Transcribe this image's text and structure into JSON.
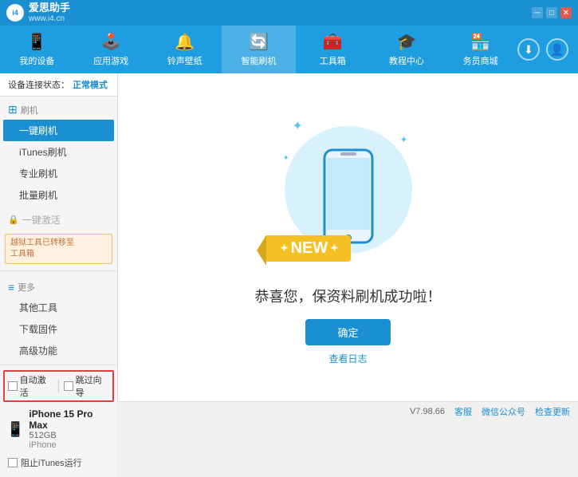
{
  "app": {
    "logo_text": "i4",
    "brand_name": "爱思助手",
    "brand_url": "www.i4.cn"
  },
  "window_controls": {
    "minimize": "─",
    "maximize": "□",
    "close": "✕"
  },
  "navbar": {
    "items": [
      {
        "id": "my-device",
        "label": "我的设备",
        "icon": "📱"
      },
      {
        "id": "apps-games",
        "label": "应用游戏",
        "icon": "👤"
      },
      {
        "id": "ringtones",
        "label": "铃声壁纸",
        "icon": "🔔"
      },
      {
        "id": "smart-flash",
        "label": "智能刷机",
        "icon": "🔄",
        "active": true
      },
      {
        "id": "toolbox",
        "label": "工具箱",
        "icon": "🧰"
      },
      {
        "id": "tutorial",
        "label": "教程中心",
        "icon": "🎓"
      },
      {
        "id": "service",
        "label": "务员商城",
        "icon": "🗂️"
      }
    ],
    "download_icon": "⬇",
    "user_icon": "👤"
  },
  "sidebar": {
    "status_label": "设备连接状态：",
    "status_mode": "正常模式",
    "section_flash": {
      "icon": "🔄",
      "label": "刷机"
    },
    "flash_items": [
      {
        "id": "one-click-flash",
        "label": "一键刷机",
        "active": true
      },
      {
        "id": "itunes-flash",
        "label": "iTunes刷机"
      },
      {
        "id": "pro-flash",
        "label": "专业刷机"
      },
      {
        "id": "batch-flash",
        "label": "批量刷机"
      }
    ],
    "one_click_activate": {
      "label": "一键激活",
      "disabled": true
    },
    "warning_text": "越狱工具已转移至\n工具箱",
    "section_more": {
      "icon": "≡",
      "label": "更多"
    },
    "more_items": [
      {
        "id": "other-tools",
        "label": "其他工具"
      },
      {
        "id": "download-firmware",
        "label": "下载固件"
      },
      {
        "id": "advanced",
        "label": "高级功能"
      }
    ],
    "auto_activate_label": "自动激活",
    "quick_guide_label": "跳过向导",
    "device": {
      "name": "iPhone 15 Pro Max",
      "storage": "512GB",
      "type": "iPhone"
    },
    "itunes_label": "阻止iTunes运行"
  },
  "content": {
    "success_title": "恭喜您，保资料刷机成功啦！",
    "confirm_button": "确定",
    "view_log": "查看日志",
    "new_badge": "NEW"
  },
  "statusbar": {
    "version": "V7.98.66",
    "client_label": "客服",
    "wechat_label": "微信公众号",
    "check_update_label": "检查更新"
  }
}
